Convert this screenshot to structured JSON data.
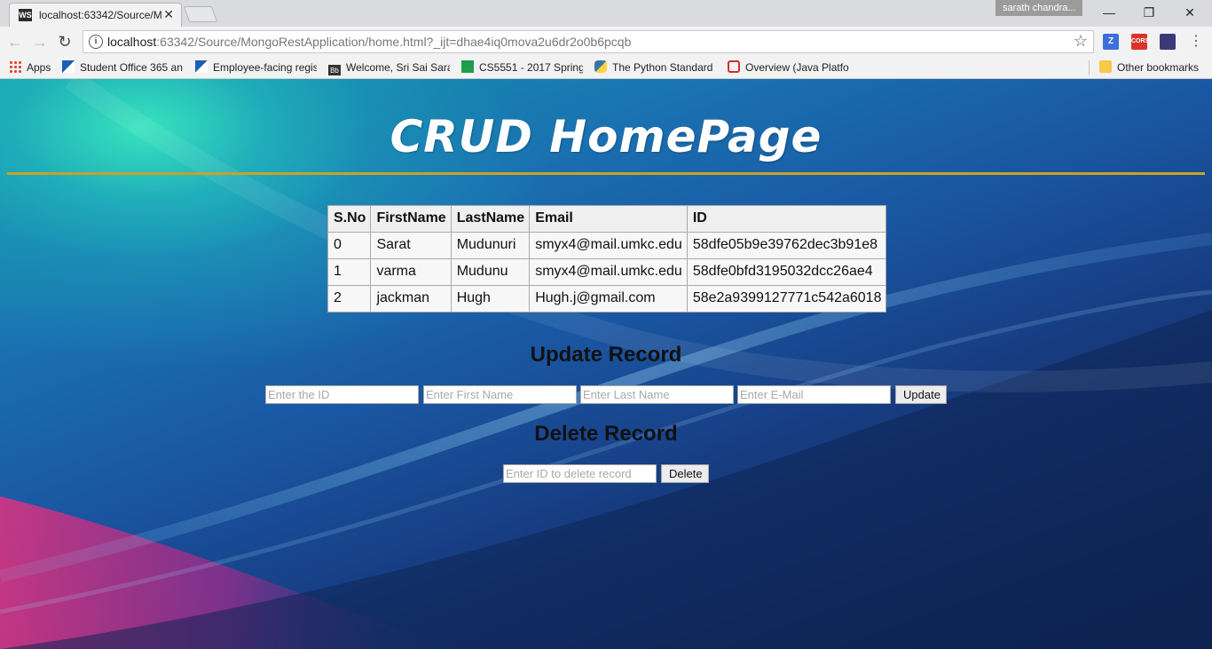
{
  "browser": {
    "tab_title": "localhost:63342/Source/M",
    "tab_favicon_text": "WS",
    "profile_name": "sarath chandra...",
    "url_host": "localhost",
    "url_rest": ":63342/Source/MongoRestApplication/home.html?_ijt=dhae4iq0mova2u6dr2o0b6pcqb",
    "extensions": [
      {
        "name": "Z",
        "color": "#3b6fd9"
      },
      {
        "name": "CORS",
        "color": "#d9342b"
      },
      {
        "name": "",
        "color": "#3a3a7a"
      }
    ],
    "bookmarks": [
      "Apps",
      "Student Office 365 an",
      "Employee-facing regis",
      "Welcome, Sri Sai Sarat",
      "CS5551 - 2017 Spring",
      "The Python Standard L",
      "Overview (Java Platfor"
    ],
    "other_bookmarks": "Other bookmarks"
  },
  "page": {
    "title": "CRUD HomePage",
    "table": {
      "headers": [
        "S.No",
        "FirstName",
        "LastName",
        "Email",
        "ID"
      ],
      "rows": [
        [
          "0",
          "Sarat",
          "Mudunuri",
          "smyx4@mail.umkc.edu",
          "58dfe05b9e39762dec3b91e8"
        ],
        [
          "1",
          "varma",
          "Mudunu",
          "smyx4@mail.umkc.edu",
          "58dfe0bfd3195032dcc26ae4"
        ],
        [
          "2",
          "jackman",
          "Hugh",
          "Hugh.j@gmail.com",
          "58e2a9399127771c542a6018"
        ]
      ]
    },
    "update": {
      "heading": "Update Record",
      "id_placeholder": "Enter the ID",
      "first_placeholder": "Enter First Name",
      "last_placeholder": "Enter Last Name",
      "email_placeholder": "Enter E-Mail",
      "button": "Update"
    },
    "delete": {
      "heading": "Delete Record",
      "id_placeholder": "Enter ID to delete record",
      "button": "Delete"
    },
    "colors": {
      "rule": "#c9a227",
      "background_top": "#159fb3",
      "background_bottom": "#0c1f4a",
      "accent_pink": "#d02d7a"
    }
  }
}
